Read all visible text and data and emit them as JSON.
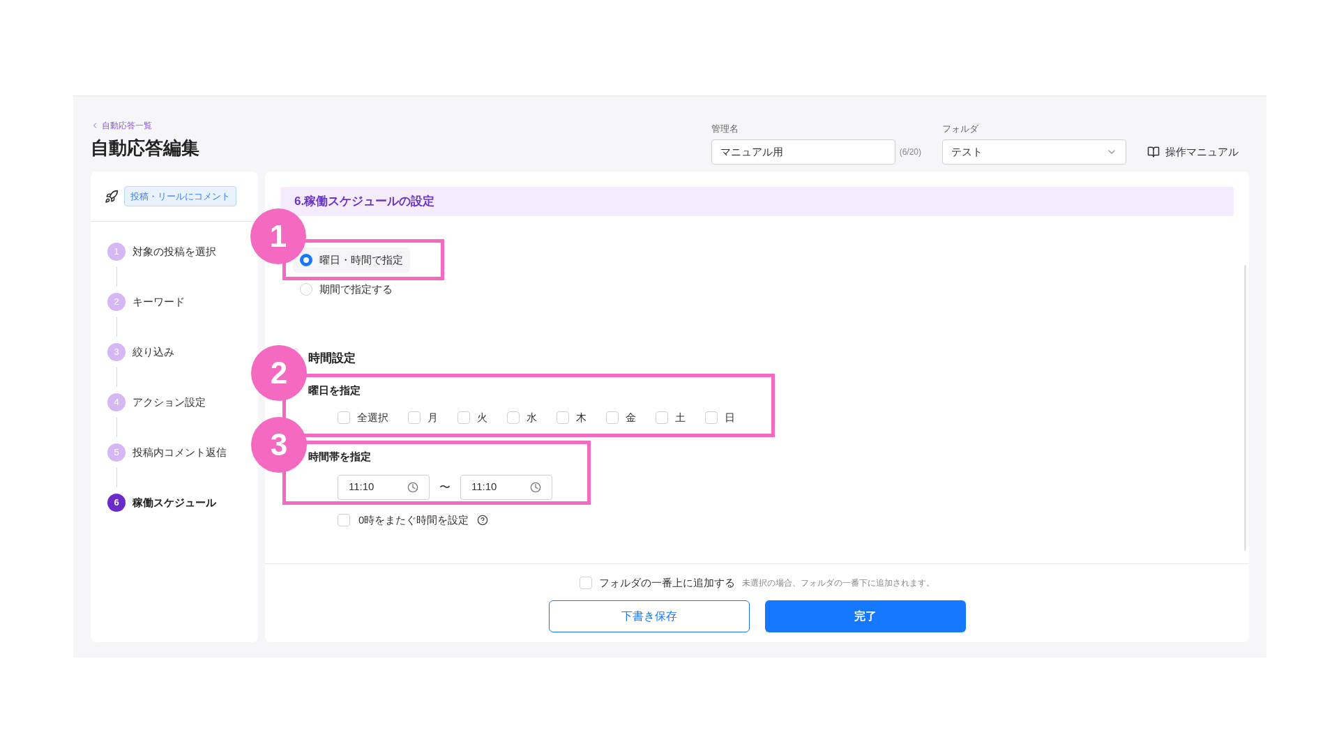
{
  "breadcrumb": "自動応答一覧",
  "title": "自動応答編集",
  "name_field": {
    "label": "管理名",
    "value": "マニュアル用",
    "counter": "(6/20)"
  },
  "folder_field": {
    "label": "フォルダ",
    "value": "テスト"
  },
  "manual_link": "操作マニュアル",
  "sidebar": {
    "trigger_tag": "投稿・リールにコメント",
    "steps": [
      {
        "number": "1",
        "label": "対象の投稿を選択",
        "selected": false
      },
      {
        "number": "2",
        "label": "キーワード",
        "selected": false
      },
      {
        "number": "3",
        "label": "絞り込み",
        "selected": false
      },
      {
        "number": "4",
        "label": "アクション設定",
        "selected": false
      },
      {
        "number": "5",
        "label": "投稿内コメント返信",
        "selected": false
      },
      {
        "number": "6",
        "label": "稼働スケジュール",
        "selected": true
      }
    ]
  },
  "section_title": "6.稼働スケジュールの設定",
  "schedule_options": [
    {
      "label": "曜日・時間で指定",
      "selected": true
    },
    {
      "label": "期間で指定する",
      "selected": false
    }
  ],
  "time_settings": {
    "heading": "時間設定",
    "days_label": "曜日を指定",
    "days": [
      {
        "label": "全選択",
        "checked": false
      },
      {
        "label": "月",
        "checked": false
      },
      {
        "label": "火",
        "checked": false
      },
      {
        "label": "水",
        "checked": false
      },
      {
        "label": "木",
        "checked": false
      },
      {
        "label": "金",
        "checked": false
      },
      {
        "label": "土",
        "checked": false
      },
      {
        "label": "日",
        "checked": false
      }
    ],
    "range_label": "時間帯を指定",
    "start_time": "11:10",
    "separator": "〜",
    "end_time": "11:10",
    "overnight": {
      "label": "0時をまたぐ時間を設定",
      "checked": false
    }
  },
  "footer": {
    "add_top": {
      "label": "フォルダの一番上に追加する",
      "checked": false
    },
    "hint": "未選択の場合、フォルダの一番下に追加されます。",
    "buttons": [
      "下書き保存",
      "完了"
    ]
  },
  "annotations": [
    "1",
    "2",
    "3"
  ]
}
